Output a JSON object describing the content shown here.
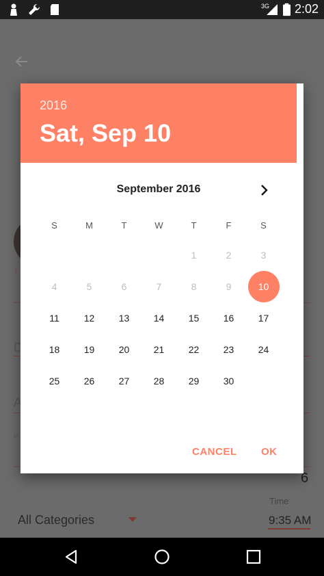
{
  "status_bar": {
    "network": "3G",
    "time": "2:02"
  },
  "background": {
    "fragments": [
      {
        "text": "D"
      },
      {
        "text": "A"
      },
      {
        "text": "T"
      },
      {
        "text": "P"
      }
    ],
    "right_digit": "6",
    "category": "All Categories",
    "time_label": "Time",
    "time_value": "9:35 AM"
  },
  "dialog": {
    "year": "2016",
    "selected_date": "Sat, Sep 10",
    "month_title": "September 2016",
    "weekdays": [
      "S",
      "M",
      "T",
      "W",
      "T",
      "F",
      "S"
    ],
    "weeks": [
      [
        null,
        null,
        null,
        null,
        "1",
        "2",
        "3"
      ],
      [
        "4",
        "5",
        "6",
        "7",
        "8",
        "9",
        "10"
      ],
      [
        "11",
        "12",
        "13",
        "14",
        "15",
        "16",
        "17"
      ],
      [
        "18",
        "19",
        "20",
        "21",
        "22",
        "23",
        "24"
      ],
      [
        "25",
        "26",
        "27",
        "28",
        "29",
        "30",
        null
      ]
    ],
    "selected_day": "10",
    "disabled_days": [
      "1",
      "2",
      "3",
      "4",
      "5",
      "6",
      "7",
      "8",
      "9"
    ],
    "cancel_label": "CANCEL",
    "ok_label": "OK",
    "accent_color": "#ff8165"
  },
  "icons": {
    "status": [
      "person-icon",
      "wrench-icon",
      "sd-card-icon",
      "signal-icon",
      "battery-icon"
    ],
    "nav": [
      "back-triangle-icon",
      "home-circle-icon",
      "recents-square-icon"
    ]
  }
}
